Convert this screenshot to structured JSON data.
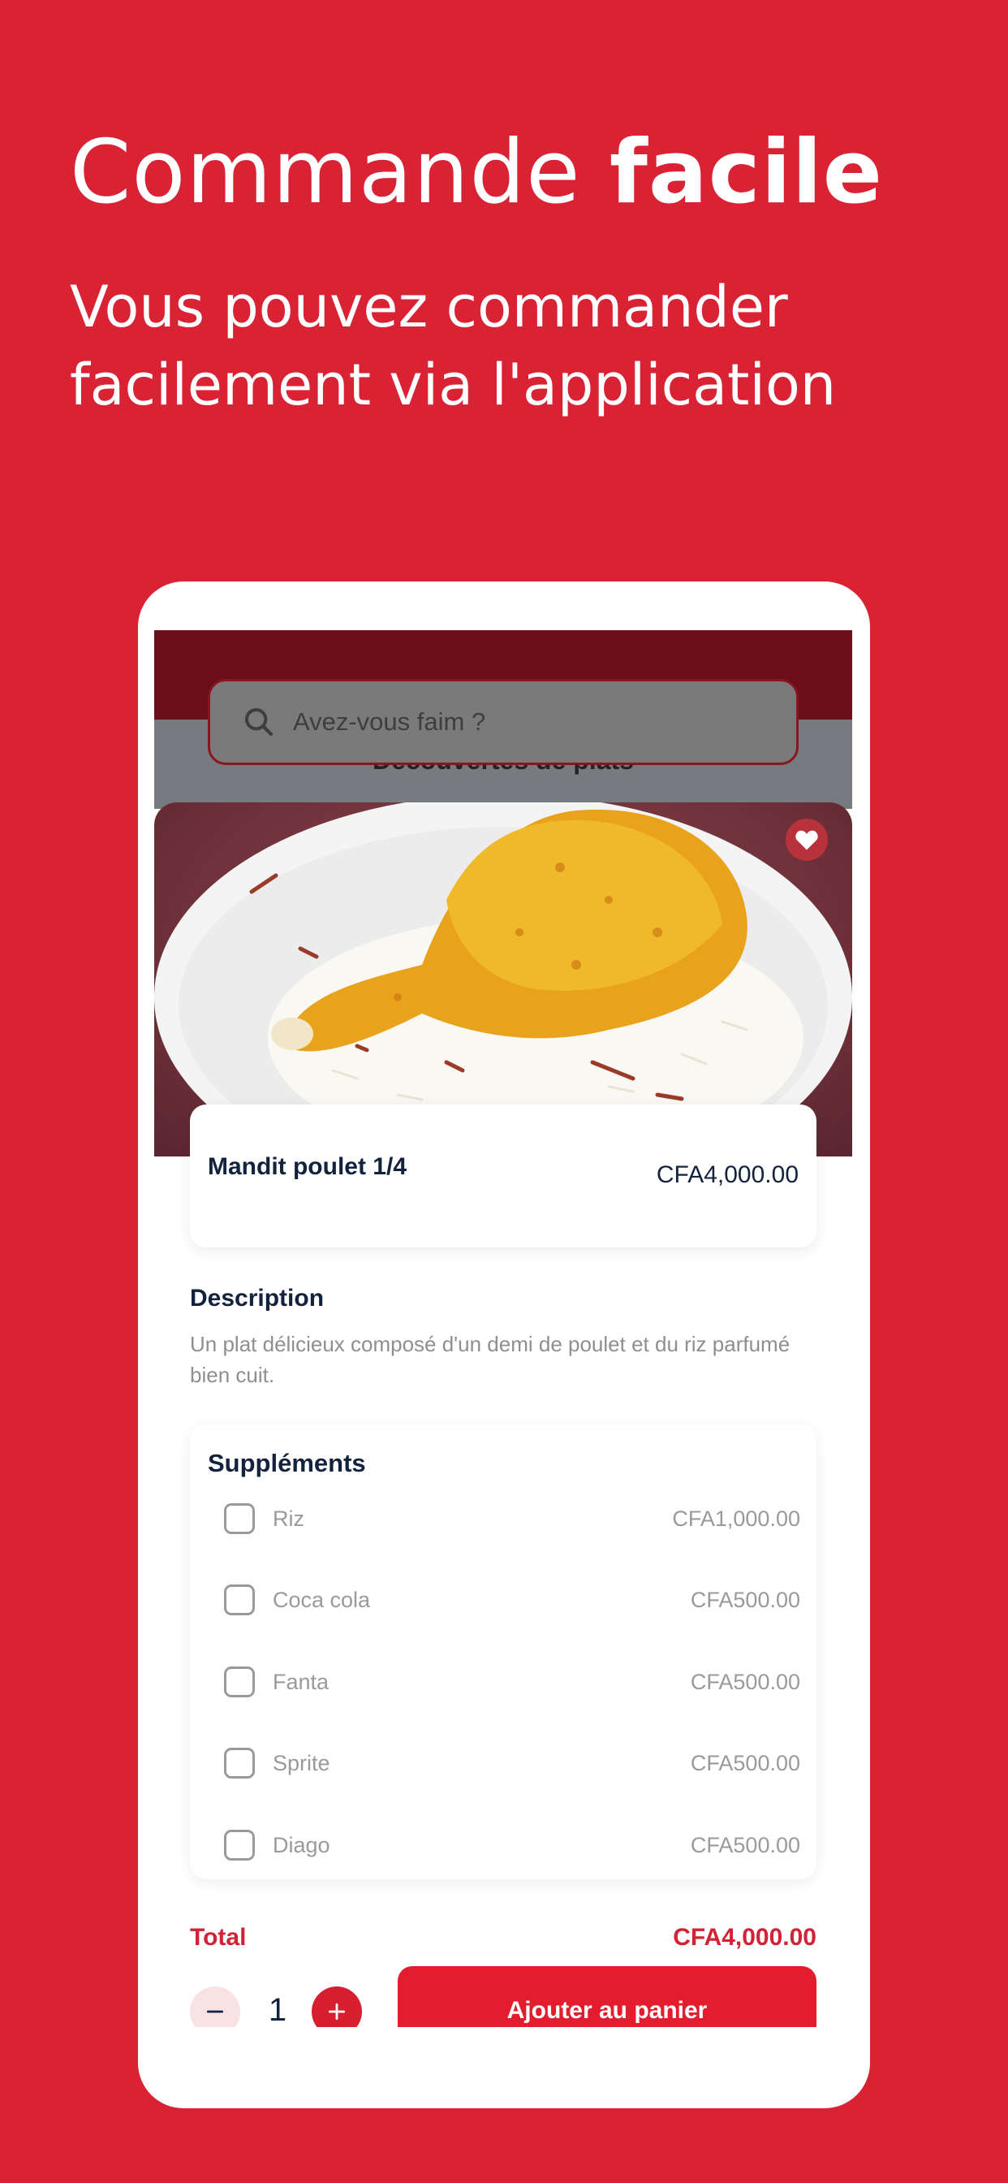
{
  "hero": {
    "title_regular": "Commande ",
    "title_bold": "facile",
    "subtitle": "Vous pouvez commander facilement via l'application"
  },
  "app": {
    "search": {
      "placeholder": "Avez-vous faim ?",
      "icon": "search-icon"
    },
    "section_peek": "Découvertes de plats",
    "favorite_icon": "heart-icon",
    "dish": {
      "name": "Mandit poulet 1/4",
      "price": "CFA4,000.00"
    },
    "description": {
      "title": "Description",
      "text": "Un plat délicieux composé d'un demi de poulet et du riz parfumé bien cuit."
    },
    "supplements": {
      "title": "Suppléments",
      "items": [
        {
          "label": "Riz",
          "price": "CFA1,000.00",
          "checked": false
        },
        {
          "label": "Coca cola",
          "price": "CFA500.00",
          "checked": false
        },
        {
          "label": "Fanta",
          "price": "CFA500.00",
          "checked": false
        },
        {
          "label": "Sprite",
          "price": "CFA500.00",
          "checked": false
        },
        {
          "label": "Diago",
          "price": "CFA500.00",
          "checked": false
        }
      ]
    },
    "footer": {
      "total_label": "Total",
      "total_value": "CFA4,000.00",
      "quantity": "1",
      "add_to_cart": "Ajouter au panier"
    }
  },
  "colors": {
    "background": "#d92335",
    "accent": "#e31c2e",
    "text_dark": "#13233d",
    "text_muted": "#8e8e93"
  }
}
